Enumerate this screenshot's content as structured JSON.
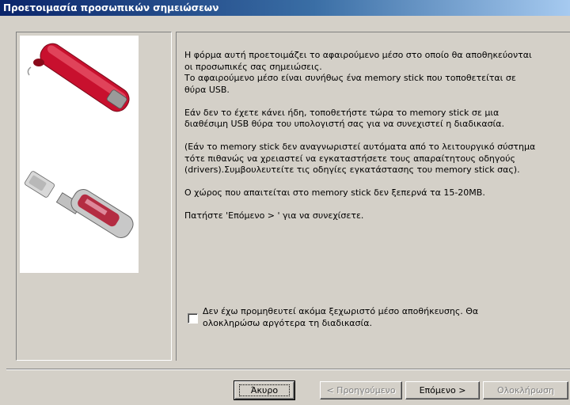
{
  "window": {
    "title": "Προετοιμασία προσωπικών σημειώσεων"
  },
  "description": {
    "para1": "Η φόρμα αυτή προετοιμάζει το αφαιρούμενο μέσο στο οποίο θα αποθηκεύονται\nοι προσωπικές σας σημειώσεις.\nΤο αφαιρούμενο μέσο είναι συνήθως ένα memory stick που τοποθετείται σε\nθύρα USB.",
    "para2": "Εάν δεν το έχετε κάνει ήδη, τοποθετήστε τώρα το memory stick σε μια\nδιαθέσιμη USB θύρα του υπολογιστή σας για να συνεχιστεί η διαδικασία.",
    "para3": "(Εάν το memory stick δεν αναγνωριστεί αυτόματα από το λειτουργικό σύστημα\nτότε πιθανώς να χρειαστεί να εγκαταστήσετε τους απαραίτητους οδηγούς\n(drivers).Συμβουλευτείτε τις οδηγίες εγκατάστασης του memory stick σας).",
    "para4": "Ο χώρος που απαιτείται στο memory stick δεν ξεπερνά τα 15-20MB.",
    "para5": "Πατήστε 'Επόμενο > ' για να συνεχίσετε."
  },
  "checkbox": {
    "label": "Δεν έχω προμηθευτεί ακόμα ξεχωριστό μέσο αποθήκευσης. Θα\nολοκληρώσω αργότερα τη διαδικασία.",
    "checked": false
  },
  "buttons": {
    "cancel": "Άκυρο",
    "previous": "< Προηγούμενο",
    "next": "Επόμενο >",
    "finish": "Ολοκλήρωση"
  },
  "colors": {
    "title_bar_start": "#0a246a",
    "title_bar_end": "#a6caf0",
    "dialog_bg": "#d4d0c8",
    "usb_red": "#c8102e"
  },
  "illustration": {
    "icon_names": [
      "red-usb-stick-icon",
      "silver-red-usb-stick-icon"
    ]
  }
}
